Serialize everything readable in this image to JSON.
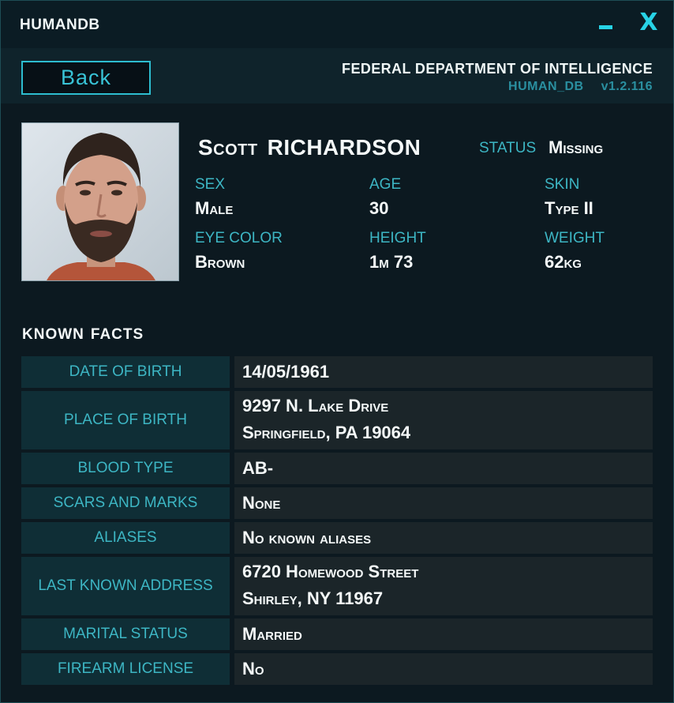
{
  "app": {
    "title": "HUMANDB",
    "minimize_glyph": "",
    "close_glyph": "X"
  },
  "header": {
    "back_label": "Back",
    "agency": "FEDERAL DEPARTMENT OF INTELLIGENCE",
    "db_name": "HUMAN_DB",
    "version": "v1.2.116"
  },
  "profile": {
    "first_name": "Scott",
    "last_name": "RICHARDSON",
    "status_label": "STATUS",
    "status_value": "Missing",
    "sex_label": "SEX",
    "sex": "Male",
    "age_label": "AGE",
    "age": "30",
    "skin_label": "SKIN",
    "skin": "Type II",
    "eye_label": "EYE COLOR",
    "eye": "Brown",
    "height_label": "HEIGHT",
    "height": "1m 73",
    "weight_label": "WEIGHT",
    "weight": "62kg"
  },
  "facts": {
    "title_1": "KNOWN",
    "title_2": "FACTS",
    "rows": [
      {
        "label": "DATE OF BIRTH",
        "lines": [
          "14/05/1961"
        ]
      },
      {
        "label": "PLACE OF BIRTH",
        "lines": [
          "9297 N. Lake Drive",
          "Springfield, PA 19064"
        ]
      },
      {
        "label": "BLOOD TYPE",
        "lines": [
          "AB-"
        ]
      },
      {
        "label": "SCARS AND MARKS",
        "lines": [
          "None"
        ]
      },
      {
        "label": "ALIASES",
        "lines": [
          "No known aliases"
        ]
      },
      {
        "label": "LAST KNOWN ADDRESS",
        "lines": [
          "6720 Homewood Street",
          "Shirley, NY 11967"
        ]
      },
      {
        "label": "MARITAL STATUS",
        "lines": [
          "Married"
        ]
      },
      {
        "label": "FIREARM LICENSE",
        "lines": [
          "No"
        ]
      }
    ]
  },
  "colors": {
    "accent": "#27d3e6",
    "label": "#3db6c4",
    "text": "#f4f8f8"
  }
}
